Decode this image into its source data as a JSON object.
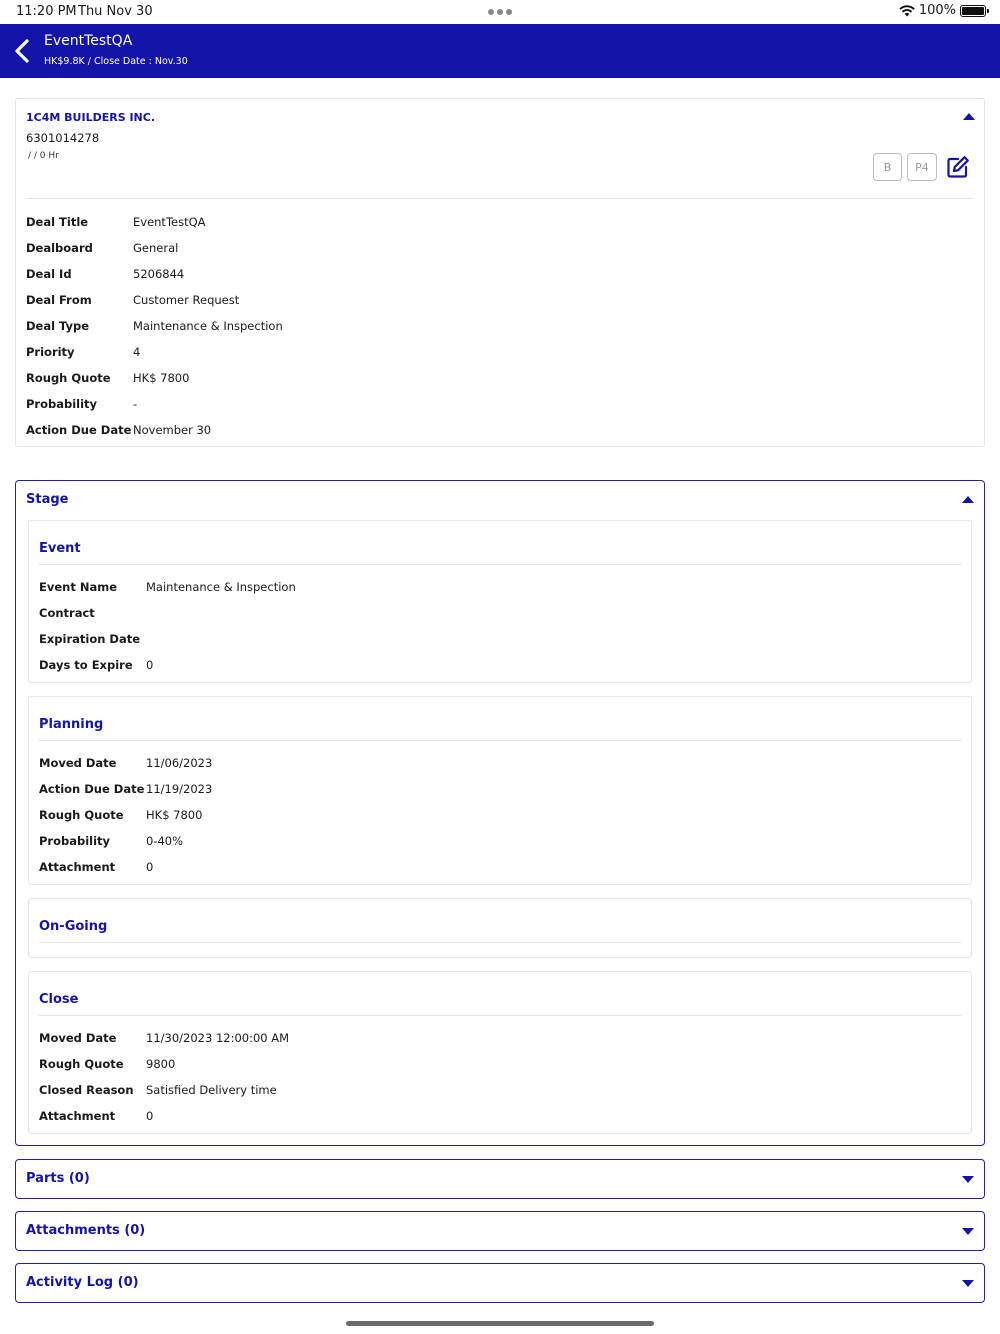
{
  "status_bar": {
    "time": "11:20 PM",
    "date": "Thu Nov 30",
    "battery": "100%"
  },
  "header": {
    "title": "EventTestQA",
    "subtitle": "HK$9.8K /  Close Date : Nov.30"
  },
  "customer": {
    "name": "1C4M BUILDERS INC.",
    "code": "6301014278",
    "meta": "/  / 0 Hr",
    "chips": [
      "B",
      "P4"
    ]
  },
  "deal": {
    "rows": [
      {
        "label": "Deal Title",
        "value": "EventTestQA"
      },
      {
        "label": "Dealboard",
        "value": "General"
      },
      {
        "label": "Deal Id",
        "value": "5206844"
      },
      {
        "label": "Deal From",
        "value": "Customer Request"
      },
      {
        "label": "Deal Type",
        "value": "Maintenance & Inspection"
      },
      {
        "label": "Priority",
        "value": "4"
      },
      {
        "label": "Rough Quote",
        "value": "HK$ 7800"
      },
      {
        "label": "Probability",
        "value": "-"
      },
      {
        "label": "Action Due Date",
        "value": "November 30"
      }
    ]
  },
  "stage": {
    "title": "Stage",
    "event": {
      "title": "Event",
      "rows": [
        {
          "label": "Event Name",
          "value": "Maintenance & Inspection"
        },
        {
          "label": "Contract",
          "value": ""
        },
        {
          "label": "Expiration Date",
          "value": ""
        },
        {
          "label": "Days to Expire",
          "value": "0"
        }
      ]
    },
    "planning": {
      "title": "Planning",
      "rows": [
        {
          "label": "Moved Date",
          "value": "11/06/2023"
        },
        {
          "label": "Action Due Date",
          "value": "11/19/2023"
        },
        {
          "label": "Rough Quote",
          "value": "HK$ 7800"
        },
        {
          "label": "Probability",
          "value": "0-40%"
        },
        {
          "label": "Attachment",
          "value": "0"
        }
      ]
    },
    "ongoing": {
      "title": "On-Going"
    },
    "close": {
      "title": "Close",
      "rows": [
        {
          "label": "Moved Date",
          "value": "11/30/2023 12:00:00 AM"
        },
        {
          "label": "Rough Quote",
          "value": "9800"
        },
        {
          "label": "Closed Reason",
          "value": "Satisfied Delivery time"
        },
        {
          "label": "Attachment",
          "value": "0"
        }
      ]
    }
  },
  "collapsed_sections": [
    {
      "title": "Parts (0)"
    },
    {
      "title": "Attachments (0)"
    },
    {
      "title": "Activity Log (0)"
    }
  ],
  "colors": {
    "primary": "#1414a8",
    "border": "#e6e6e6",
    "chip": "#bdbdbd"
  },
  "icons": {
    "back": "chevron-left-icon",
    "edit": "edit-icon",
    "expand": "caret-down-icon",
    "collapse": "caret-up-icon",
    "wifi": "wifi-icon",
    "battery": "battery-icon"
  }
}
